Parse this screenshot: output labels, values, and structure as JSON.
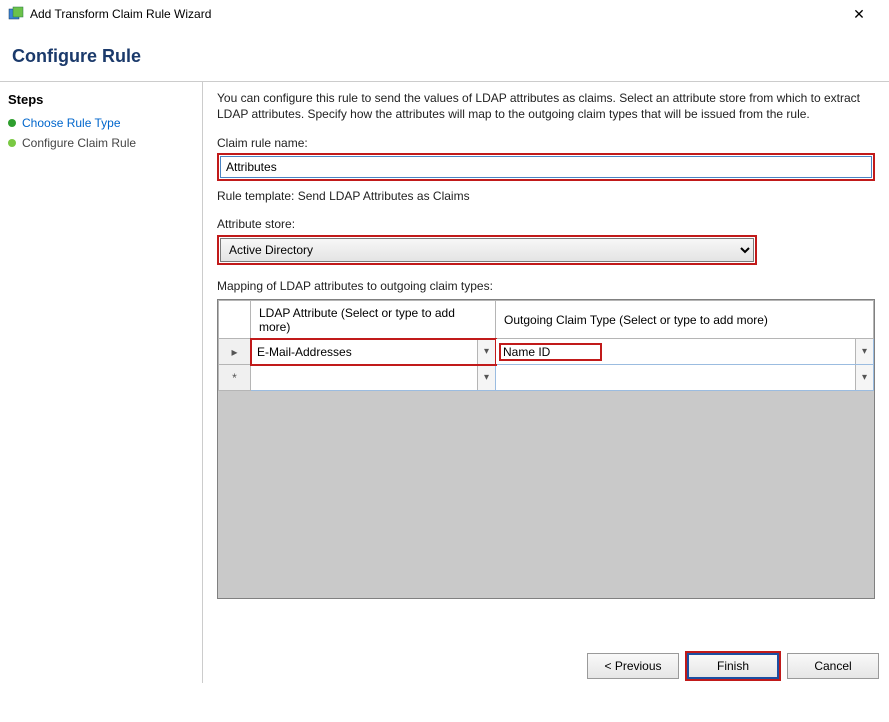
{
  "window": {
    "title": "Add Transform Claim Rule Wizard",
    "close": "✕"
  },
  "header": {
    "title": "Configure Rule"
  },
  "sidebar": {
    "heading": "Steps",
    "items": [
      {
        "label": "Choose Rule Type"
      },
      {
        "label": "Configure Claim Rule"
      }
    ]
  },
  "main": {
    "intro": "You can configure this rule to send the values of LDAP attributes as claims. Select an attribute store from which to extract LDAP attributes. Specify how the attributes will map to the outgoing claim types that will be issued from the rule.",
    "claim_rule_name_label": "Claim rule name:",
    "claim_rule_name_value": "Attributes",
    "rule_template_line": "Rule template: Send LDAP Attributes as Claims",
    "attribute_store_label": "Attribute store:",
    "attribute_store_value": "Active Directory",
    "mapping_label": "Mapping of LDAP attributes to outgoing claim types:",
    "grid": {
      "col1": "LDAP Attribute (Select or type to add more)",
      "col2": "Outgoing Claim Type (Select or type to add more)",
      "rows": [
        {
          "marker": "▸",
          "ldap": "E-Mail-Addresses",
          "claim": "Name ID"
        },
        {
          "marker": "*",
          "ldap": "",
          "claim": ""
        }
      ]
    }
  },
  "buttons": {
    "previous": "< Previous",
    "finish": "Finish",
    "cancel": "Cancel"
  }
}
